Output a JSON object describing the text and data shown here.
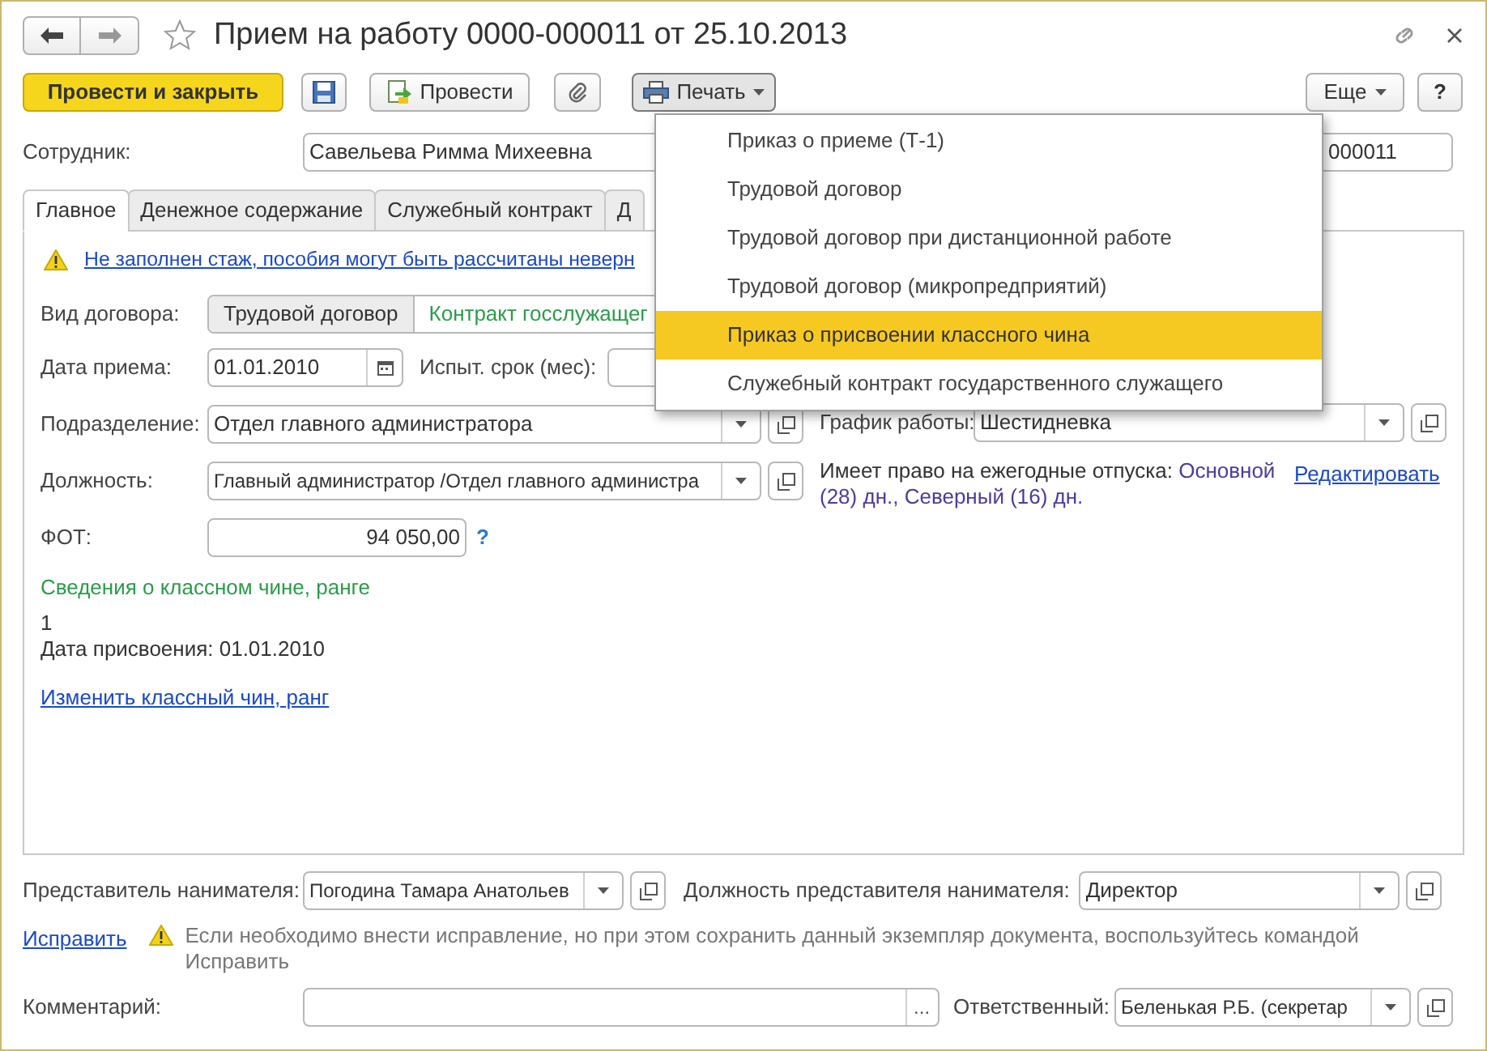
{
  "window": {
    "title": "Прием на работу 0000-000011 от 25.10.2013",
    "favorite": false
  },
  "toolbar": {
    "post_close": "Провести и закрыть",
    "post": "Провести",
    "print": {
      "label": "Печать",
      "expanded": true
    },
    "more": "Еще",
    "help": "?"
  },
  "print_menu": [
    {
      "label": "Приказ о приеме (Т-1)",
      "selected": false
    },
    {
      "label": "Трудовой договор",
      "selected": false
    },
    {
      "label": "Трудовой договор при дистанционной работе",
      "selected": false
    },
    {
      "label": "Трудовой договор (микропредприятий)",
      "selected": false
    },
    {
      "label": "Приказ о присвоении классного чина",
      "selected": true
    },
    {
      "label": "Служебный контракт государственного служащего",
      "selected": false
    }
  ],
  "employee": {
    "label": "Сотрудник:",
    "value": "Савельева Римма Михеевна"
  },
  "number": {
    "value": "000011"
  },
  "tabs": [
    {
      "label": "Главное",
      "selected": true
    },
    {
      "label": "Денежное содержание",
      "selected": false
    },
    {
      "label": "Служебный контракт",
      "selected": false
    },
    {
      "label": "Д",
      "selected": false
    }
  ],
  "warning": "Не заполнен стаж, пособия могут быть рассчитаны неверн",
  "contract_type": {
    "label": "Вид договора:",
    "options": [
      {
        "label": "Трудовой договор",
        "selected": false
      },
      {
        "label": "Контракт госслужащег",
        "selected": true
      }
    ]
  },
  "hire_date": {
    "label": "Дата приема:",
    "value": "01.01.2010"
  },
  "probation": {
    "label": "Испыт. срок (мес):"
  },
  "department": {
    "label": "Подразделение:",
    "value": "Отдел главного администратора"
  },
  "position": {
    "label": "Должность:",
    "value": "Главный администратор /Отдел главного администра"
  },
  "payroll": {
    "label": "ФОТ:",
    "value": "94 050,00",
    "help": "?"
  },
  "rank": {
    "heading": "Сведения о классном чине, ранге",
    "value": "1",
    "date": "Дата присвоения: 01.01.2010",
    "link": "Изменить классный чин, ранг"
  },
  "schedule": {
    "label": "График работы:",
    "value": "Шестидневка"
  },
  "vacation": {
    "label": "Имеет право на ежегодные отпуска:",
    "value": "Основной (28) дн., Северный (16) дн.",
    "link": "Редактировать"
  },
  "employer_rep": {
    "label": "Представитель нанимателя:",
    "value": "Погодина Тамара Анатольев"
  },
  "rep_position": {
    "label": "Должность представителя нанимателя:",
    "value": "Директор"
  },
  "correction": {
    "link": "Исправить",
    "note": "Если необходимо внести исправление, но при этом сохранить данный экземпляр документа, воспользуйтесь командой Исправить"
  },
  "comment": {
    "label": "Комментарий:",
    "select_button": "..."
  },
  "responsible": {
    "label": "Ответственный:",
    "value": "Беленькая Р.Б. (секретар"
  }
}
